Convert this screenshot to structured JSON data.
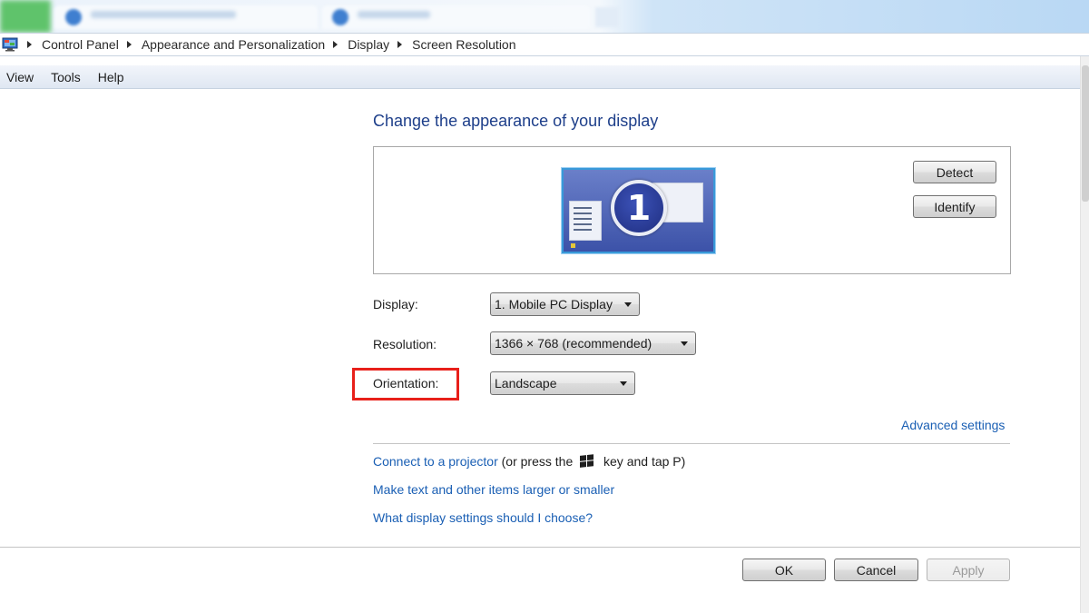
{
  "breadcrumb": {
    "items": [
      "Control Panel",
      "Appearance and Personalization",
      "Display",
      "Screen Resolution"
    ]
  },
  "menu": {
    "items": [
      "View",
      "Tools",
      "Help"
    ]
  },
  "main": {
    "title": "Change the appearance of your display",
    "monitor_number": "1",
    "detect_label": "Detect",
    "identify_label": "Identify",
    "display_label": "Display:",
    "display_value": "1. Mobile PC Display",
    "resolution_label": "Resolution:",
    "resolution_value": "1366 × 768 (recommended)",
    "orientation_label": "Orientation:",
    "orientation_value": "Landscape",
    "advanced_settings_label": "Advanced settings",
    "projector_link": "Connect to a projector",
    "projector_note_1": "(or press the",
    "projector_note_2": "key and tap P)",
    "text_size_link": "Make text and other items larger or smaller",
    "help_link": "What display settings should I choose?"
  },
  "footer": {
    "ok_label": "OK",
    "cancel_label": "Cancel",
    "apply_label": "Apply"
  },
  "colors": {
    "link": "#1a5fb4",
    "title": "#1e3f8a",
    "highlight": "#e8201a"
  },
  "icons": {
    "breadcrumb_app": "control-panel-icon",
    "separator": "breadcrumb-arrow-icon",
    "windows_key": "windows-logo-icon"
  }
}
